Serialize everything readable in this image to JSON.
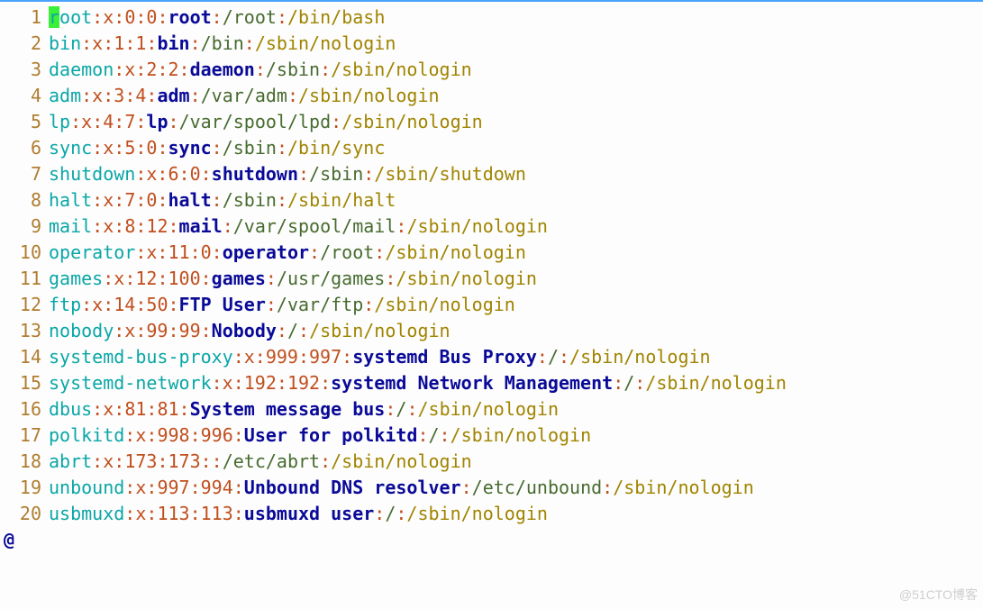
{
  "lines": [
    {
      "n": "1",
      "u": "root",
      "x": "x",
      "uid": "0",
      "gid": "0",
      "g": "root",
      "d": "/root",
      "s": "/bin/bash"
    },
    {
      "n": "2",
      "u": "bin",
      "x": "x",
      "uid": "1",
      "gid": "1",
      "g": "bin",
      "d": "/bin",
      "s": "/sbin/nologin"
    },
    {
      "n": "3",
      "u": "daemon",
      "x": "x",
      "uid": "2",
      "gid": "2",
      "g": "daemon",
      "d": "/sbin",
      "s": "/sbin/nologin"
    },
    {
      "n": "4",
      "u": "adm",
      "x": "x",
      "uid": "3",
      "gid": "4",
      "g": "adm",
      "d": "/var/adm",
      "s": "/sbin/nologin"
    },
    {
      "n": "5",
      "u": "lp",
      "x": "x",
      "uid": "4",
      "gid": "7",
      "g": "lp",
      "d": "/var/spool/lpd",
      "s": "/sbin/nologin"
    },
    {
      "n": "6",
      "u": "sync",
      "x": "x",
      "uid": "5",
      "gid": "0",
      "g": "sync",
      "d": "/sbin",
      "s": "/bin/sync"
    },
    {
      "n": "7",
      "u": "shutdown",
      "x": "x",
      "uid": "6",
      "gid": "0",
      "g": "shutdown",
      "d": "/sbin",
      "s": "/sbin/shutdown"
    },
    {
      "n": "8",
      "u": "halt",
      "x": "x",
      "uid": "7",
      "gid": "0",
      "g": "halt",
      "d": "/sbin",
      "s": "/sbin/halt"
    },
    {
      "n": "9",
      "u": "mail",
      "x": "x",
      "uid": "8",
      "gid": "12",
      "g": "mail",
      "d": "/var/spool/mail",
      "s": "/sbin/nologin"
    },
    {
      "n": "10",
      "u": "operator",
      "x": "x",
      "uid": "11",
      "gid": "0",
      "g": "operator",
      "d": "/root",
      "s": "/sbin/nologin"
    },
    {
      "n": "11",
      "u": "games",
      "x": "x",
      "uid": "12",
      "gid": "100",
      "g": "games",
      "d": "/usr/games",
      "s": "/sbin/nologin"
    },
    {
      "n": "12",
      "u": "ftp",
      "x": "x",
      "uid": "14",
      "gid": "50",
      "g": "FTP User",
      "d": "/var/ftp",
      "s": "/sbin/nologin"
    },
    {
      "n": "13",
      "u": "nobody",
      "x": "x",
      "uid": "99",
      "gid": "99",
      "g": "Nobody",
      "d": "/",
      "s": "/sbin/nologin"
    },
    {
      "n": "14",
      "u": "systemd-bus-proxy",
      "x": "x",
      "uid": "999",
      "gid": "997",
      "g": "systemd Bus Proxy",
      "d": "/",
      "s": "/sbin/nologin"
    },
    {
      "n": "15",
      "u": "systemd-network",
      "x": "x",
      "uid": "192",
      "gid": "192",
      "g": "systemd Network Management",
      "d": "/",
      "s": "/sbin/nologin"
    },
    {
      "n": "16",
      "u": "dbus",
      "x": "x",
      "uid": "81",
      "gid": "81",
      "g": "System message bus",
      "d": "/",
      "s": "/sbin/nologin"
    },
    {
      "n": "17",
      "u": "polkitd",
      "x": "x",
      "uid": "998",
      "gid": "996",
      "g": "User for polkitd",
      "d": "/",
      "s": "/sbin/nologin"
    },
    {
      "n": "18",
      "u": "abrt",
      "x": "x",
      "uid": "173",
      "gid": "173",
      "g": "",
      "d": "/etc/abrt",
      "s": "/sbin/nologin"
    },
    {
      "n": "19",
      "u": "unbound",
      "x": "x",
      "uid": "997",
      "gid": "994",
      "g": "Unbound DNS resolver",
      "d": "/etc/unbound",
      "s": "/sbin/nologin"
    },
    {
      "n": "20",
      "u": "usbmuxd",
      "x": "x",
      "uid": "113",
      "gid": "113",
      "g": "usbmuxd user",
      "d": "/",
      "s": "/sbin/nologin"
    }
  ],
  "footer": "@",
  "watermark": "@51CTO博客"
}
